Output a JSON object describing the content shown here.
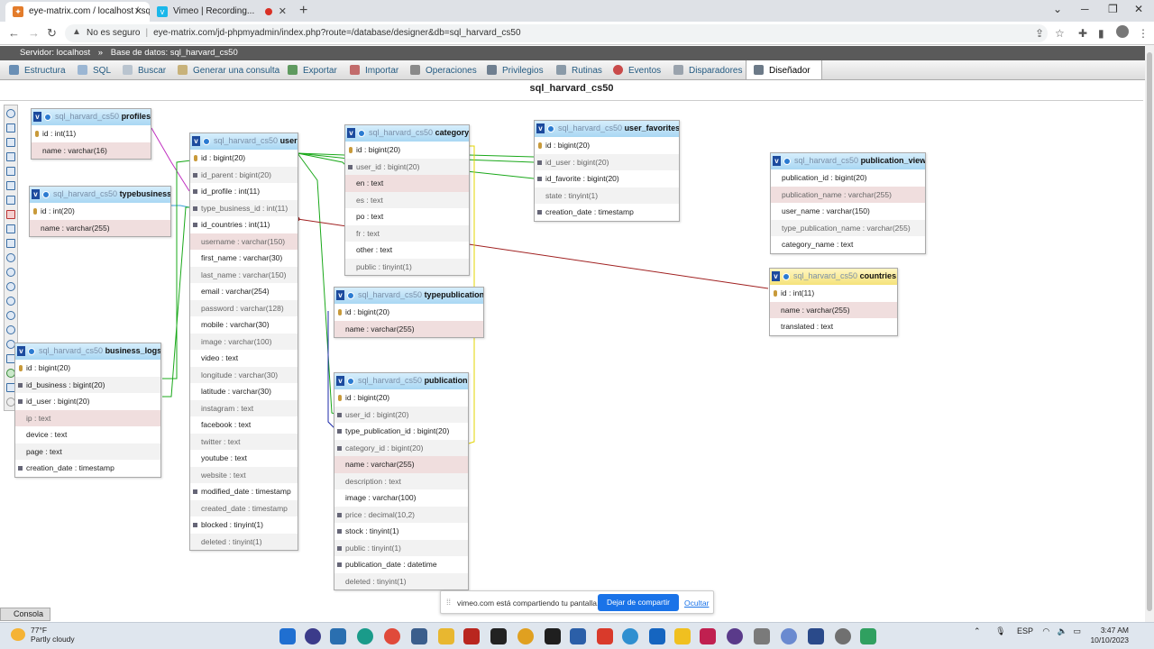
{
  "browser": {
    "tabs": [
      {
        "title": "eye-matrix.com / localhost / sql_",
        "active": true
      },
      {
        "title": "Vimeo | Recording...",
        "active": false
      }
    ],
    "security_label": "No es seguro",
    "url": "eye-matrix.com/jd-phpmyadmin/index.php?route=/database/designer&db=sql_harvard_cs50"
  },
  "breadcrumb": {
    "server": "Servidor: localhost",
    "separator": "»",
    "database": "Base de datos: sql_harvard_cs50"
  },
  "menu": {
    "items": [
      "Estructura",
      "SQL",
      "Buscar",
      "Generar una consulta",
      "Exportar",
      "Importar",
      "Operaciones",
      "Privilegios",
      "Rutinas",
      "Eventos",
      "Disparadores",
      "Diseñador"
    ]
  },
  "designer": {
    "title": "sql_harvard_cs50",
    "db_prefix": "sql_harvard_cs50",
    "tables": {
      "profiles": {
        "name": "profiles",
        "cols": [
          "id : int(11)",
          "name : varchar(16)"
        ]
      },
      "typebusiness": {
        "name": "typebusiness",
        "cols": [
          "id : int(20)",
          "name : varchar(255)"
        ]
      },
      "business_logs": {
        "name": "business_logs",
        "cols": [
          "id : bigint(20)",
          "id_business : bigint(20)",
          "id_user : bigint(20)",
          "ip : text",
          "device : text",
          "page : text",
          "creation_date : timestamp"
        ]
      },
      "user": {
        "name": "user",
        "cols": [
          "id : bigint(20)",
          "id_parent : bigint(20)",
          "id_profile : int(11)",
          "type_business_id : int(11)",
          "id_countries : int(11)",
          "username : varchar(150)",
          "first_name : varchar(30)",
          "last_name : varchar(150)",
          "email : varchar(254)",
          "password : varchar(128)",
          "mobile : varchar(30)",
          "image : varchar(100)",
          "video : text",
          "longitude : varchar(30)",
          "latitude : varchar(30)",
          "instagram : text",
          "facebook : text",
          "twitter : text",
          "youtube : text",
          "website : text",
          "modified_date : timestamp",
          "created_date : timestamp",
          "blocked : tinyint(1)",
          "deleted : tinyint(1)"
        ]
      },
      "category": {
        "name": "category",
        "cols": [
          "id : bigint(20)",
          "user_id : bigint(20)",
          "en : text",
          "es : text",
          "po : text",
          "fr : text",
          "other : text",
          "public : tinyint(1)"
        ]
      },
      "typepublication": {
        "name": "typepublication",
        "cols": [
          "id : bigint(20)",
          "name : varchar(255)"
        ]
      },
      "publication": {
        "name": "publication",
        "cols": [
          "id : bigint(20)",
          "user_id : bigint(20)",
          "type_publication_id : bigint(20)",
          "category_id : bigint(20)",
          "name : varchar(255)",
          "description : text",
          "image : varchar(100)",
          "price : decimal(10,2)",
          "stock : tinyint(1)",
          "public : tinyint(1)",
          "publication_date : datetime",
          "deleted : tinyint(1)"
        ]
      },
      "user_favorites": {
        "name": "user_favorites",
        "cols": [
          "id : bigint(20)",
          "id_user : bigint(20)",
          "id_favorite : bigint(20)",
          "state : tinyint(1)",
          "creation_date : timestamp"
        ]
      },
      "publication_view": {
        "name": "publication_view",
        "cols": [
          "publication_id : bigint(20)",
          "publication_name : varchar(255)",
          "user_name : varchar(150)",
          "type_publication_name : varchar(255)",
          "category_name : text"
        ]
      },
      "countries": {
        "name": "countries",
        "cols": [
          "id : int(11)",
          "name : varchar(255)",
          "translated : text"
        ]
      }
    }
  },
  "console_label": "Consola",
  "share_bar": {
    "message": "vimeo.com está compartiendo tu pantalla.",
    "stop_label": "Dejar de compartir",
    "hide_label": "Ocultar"
  },
  "taskbar": {
    "temperature": "77°F",
    "weather": "Partly cloudy",
    "language": "ESP",
    "time": "3:47 AM",
    "date": "10/10/2023"
  }
}
